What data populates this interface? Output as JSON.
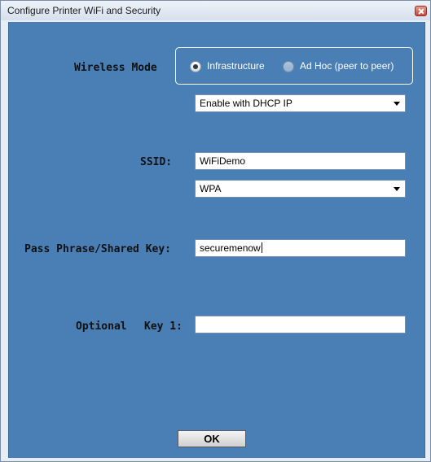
{
  "window": {
    "title": "Configure Printer WiFi and Security"
  },
  "wireless_mode": {
    "label": "Wireless Mode",
    "options": [
      "Infrastructure",
      "Ad Hoc (peer to peer)"
    ],
    "selected": "Infrastructure"
  },
  "ip_mode": {
    "value": "Enable with DHCP IP"
  },
  "ssid": {
    "label": "SSID:",
    "value": "WiFiDemo"
  },
  "security": {
    "value": "WPA"
  },
  "pass_phrase": {
    "label": "Pass Phrase/Shared Key:",
    "value": "securemenow"
  },
  "optional_key": {
    "label_prefix": "Optional",
    "label": "Key 1:",
    "value": ""
  },
  "buttons": {
    "ok": "OK"
  }
}
